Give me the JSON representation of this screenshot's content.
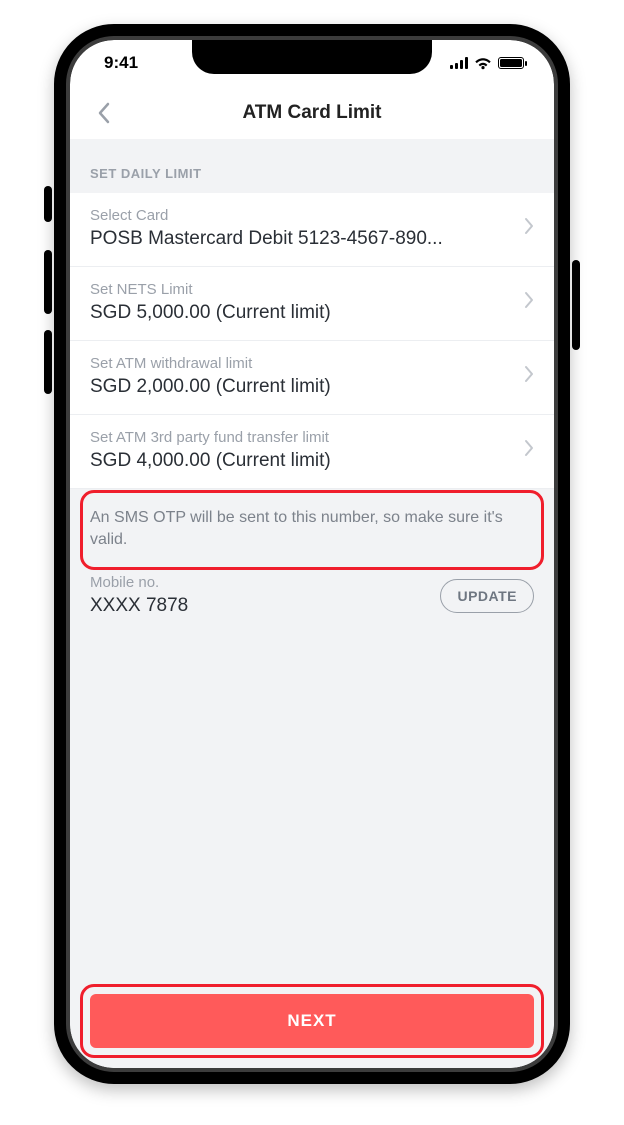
{
  "status": {
    "time": "9:41"
  },
  "nav": {
    "title": "ATM Card Limit"
  },
  "section_label": "SET DAILY LIMIT",
  "rows": {
    "card": {
      "label": "Select Card",
      "value": "POSB Mastercard Debit 5123-4567-890..."
    },
    "nets": {
      "label": "Set NETS Limit",
      "value": "SGD 5,000.00 (Current limit)"
    },
    "atm": {
      "label": "Set ATM withdrawal limit",
      "value": "SGD 2,000.00 (Current limit)"
    },
    "third": {
      "label": "Set ATM 3rd party fund transfer limit",
      "value": "SGD 4,000.00 (Current limit)"
    }
  },
  "info_text": "An SMS OTP will be sent to this number, so make sure it's valid.",
  "mobile": {
    "label": "Mobile no.",
    "value": "XXXX 7878",
    "update_label": "UPDATE"
  },
  "next_label": "NEXT",
  "colors": {
    "accent": "#ff5a5a",
    "highlight": "#f01e2c"
  }
}
